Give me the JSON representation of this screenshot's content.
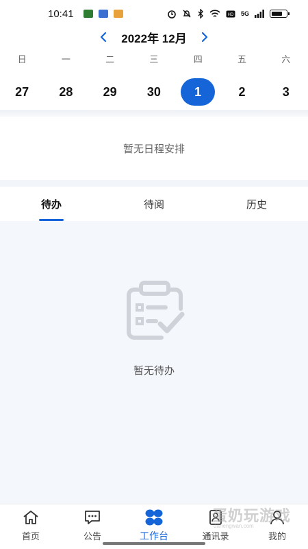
{
  "status_bar": {
    "time": "10:41",
    "network": "5G",
    "icons": [
      "alarm-icon",
      "mute-icon",
      "bluetooth-icon",
      "wifi-icon",
      "hd-icon",
      "signal-icon",
      "battery-icon"
    ]
  },
  "calendar": {
    "month_title": "2022年 12月",
    "weekdays": [
      "日",
      "一",
      "二",
      "三",
      "四",
      "五",
      "六"
    ],
    "dates": [
      "27",
      "28",
      "29",
      "30",
      "1",
      "2",
      "3"
    ],
    "selected_date": "1",
    "accent": "#1565d8"
  },
  "schedule": {
    "empty_text": "暂无日程安排"
  },
  "tabs": [
    {
      "label": "待办",
      "active": true
    },
    {
      "label": "待阅",
      "active": false
    },
    {
      "label": "历史",
      "active": false
    }
  ],
  "todo": {
    "empty_text": "暂无待办"
  },
  "bottom_nav": [
    {
      "label": "首页",
      "icon": "home-icon"
    },
    {
      "label": "公告",
      "icon": "chat-icon"
    },
    {
      "label": "工作台",
      "icon": "workbench-icon",
      "active": true
    },
    {
      "label": "通讯录",
      "icon": "contacts-icon"
    },
    {
      "label": "我的",
      "icon": "profile-icon"
    }
  ],
  "watermark": {
    "main": "蛋奶玩游戏",
    "sub": "danengwan.com"
  }
}
